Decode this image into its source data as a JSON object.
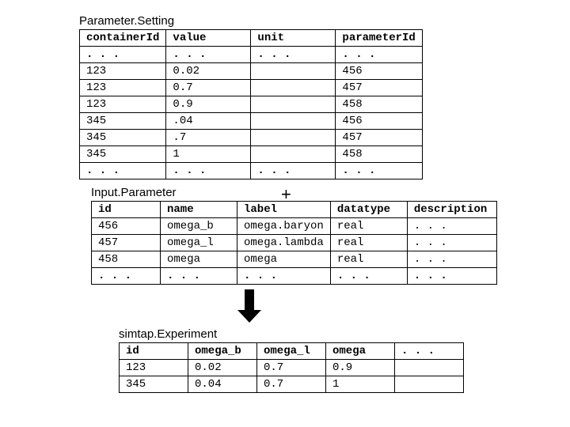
{
  "parameterSetting": {
    "title": "Parameter.Setting",
    "headers": [
      "containerId",
      "value",
      "unit",
      "parameterId"
    ],
    "ellipsis": ". . .",
    "rows": [
      {
        "containerId": "123",
        "value": "0.02",
        "unit": "",
        "parameterId": "456"
      },
      {
        "containerId": "123",
        "value": "0.7",
        "unit": "",
        "parameterId": "457"
      },
      {
        "containerId": "123",
        "value": "0.9",
        "unit": "",
        "parameterId": "458"
      },
      {
        "containerId": "345",
        "value": ".04",
        "unit": "",
        "parameterId": "456"
      },
      {
        "containerId": "345",
        "value": ".7",
        "unit": "",
        "parameterId": "457"
      },
      {
        "containerId": "345",
        "value": "1",
        "unit": "",
        "parameterId": "458"
      }
    ]
  },
  "inputParameter": {
    "title": "Input.Parameter",
    "plus": "+",
    "headers": [
      "id",
      "name",
      "label",
      "datatype",
      "description"
    ],
    "ellipsis": ". . .",
    "rows": [
      {
        "id": "456",
        "name": "omega_b",
        "label": "omega.baryon",
        "datatype": "real",
        "description": ". . ."
      },
      {
        "id": "457",
        "name": "omega_l",
        "label": "omega.lambda",
        "datatype": "real",
        "description": ". . ."
      },
      {
        "id": "458",
        "name": "omega",
        "label": "omega",
        "datatype": "real",
        "description": ". . ."
      }
    ]
  },
  "experiment": {
    "title": "simtap.Experiment",
    "headers": [
      "id",
      "omega_b",
      "omega_l",
      "omega",
      ". . ."
    ],
    "rows": [
      {
        "id": "123",
        "omega_b": "0.02",
        "omega_l": "0.7",
        "omega": "0.9",
        "extra": ""
      },
      {
        "id": "345",
        "omega_b": "0.04",
        "omega_l": "0.7",
        "omega": "1",
        "extra": ""
      }
    ]
  }
}
